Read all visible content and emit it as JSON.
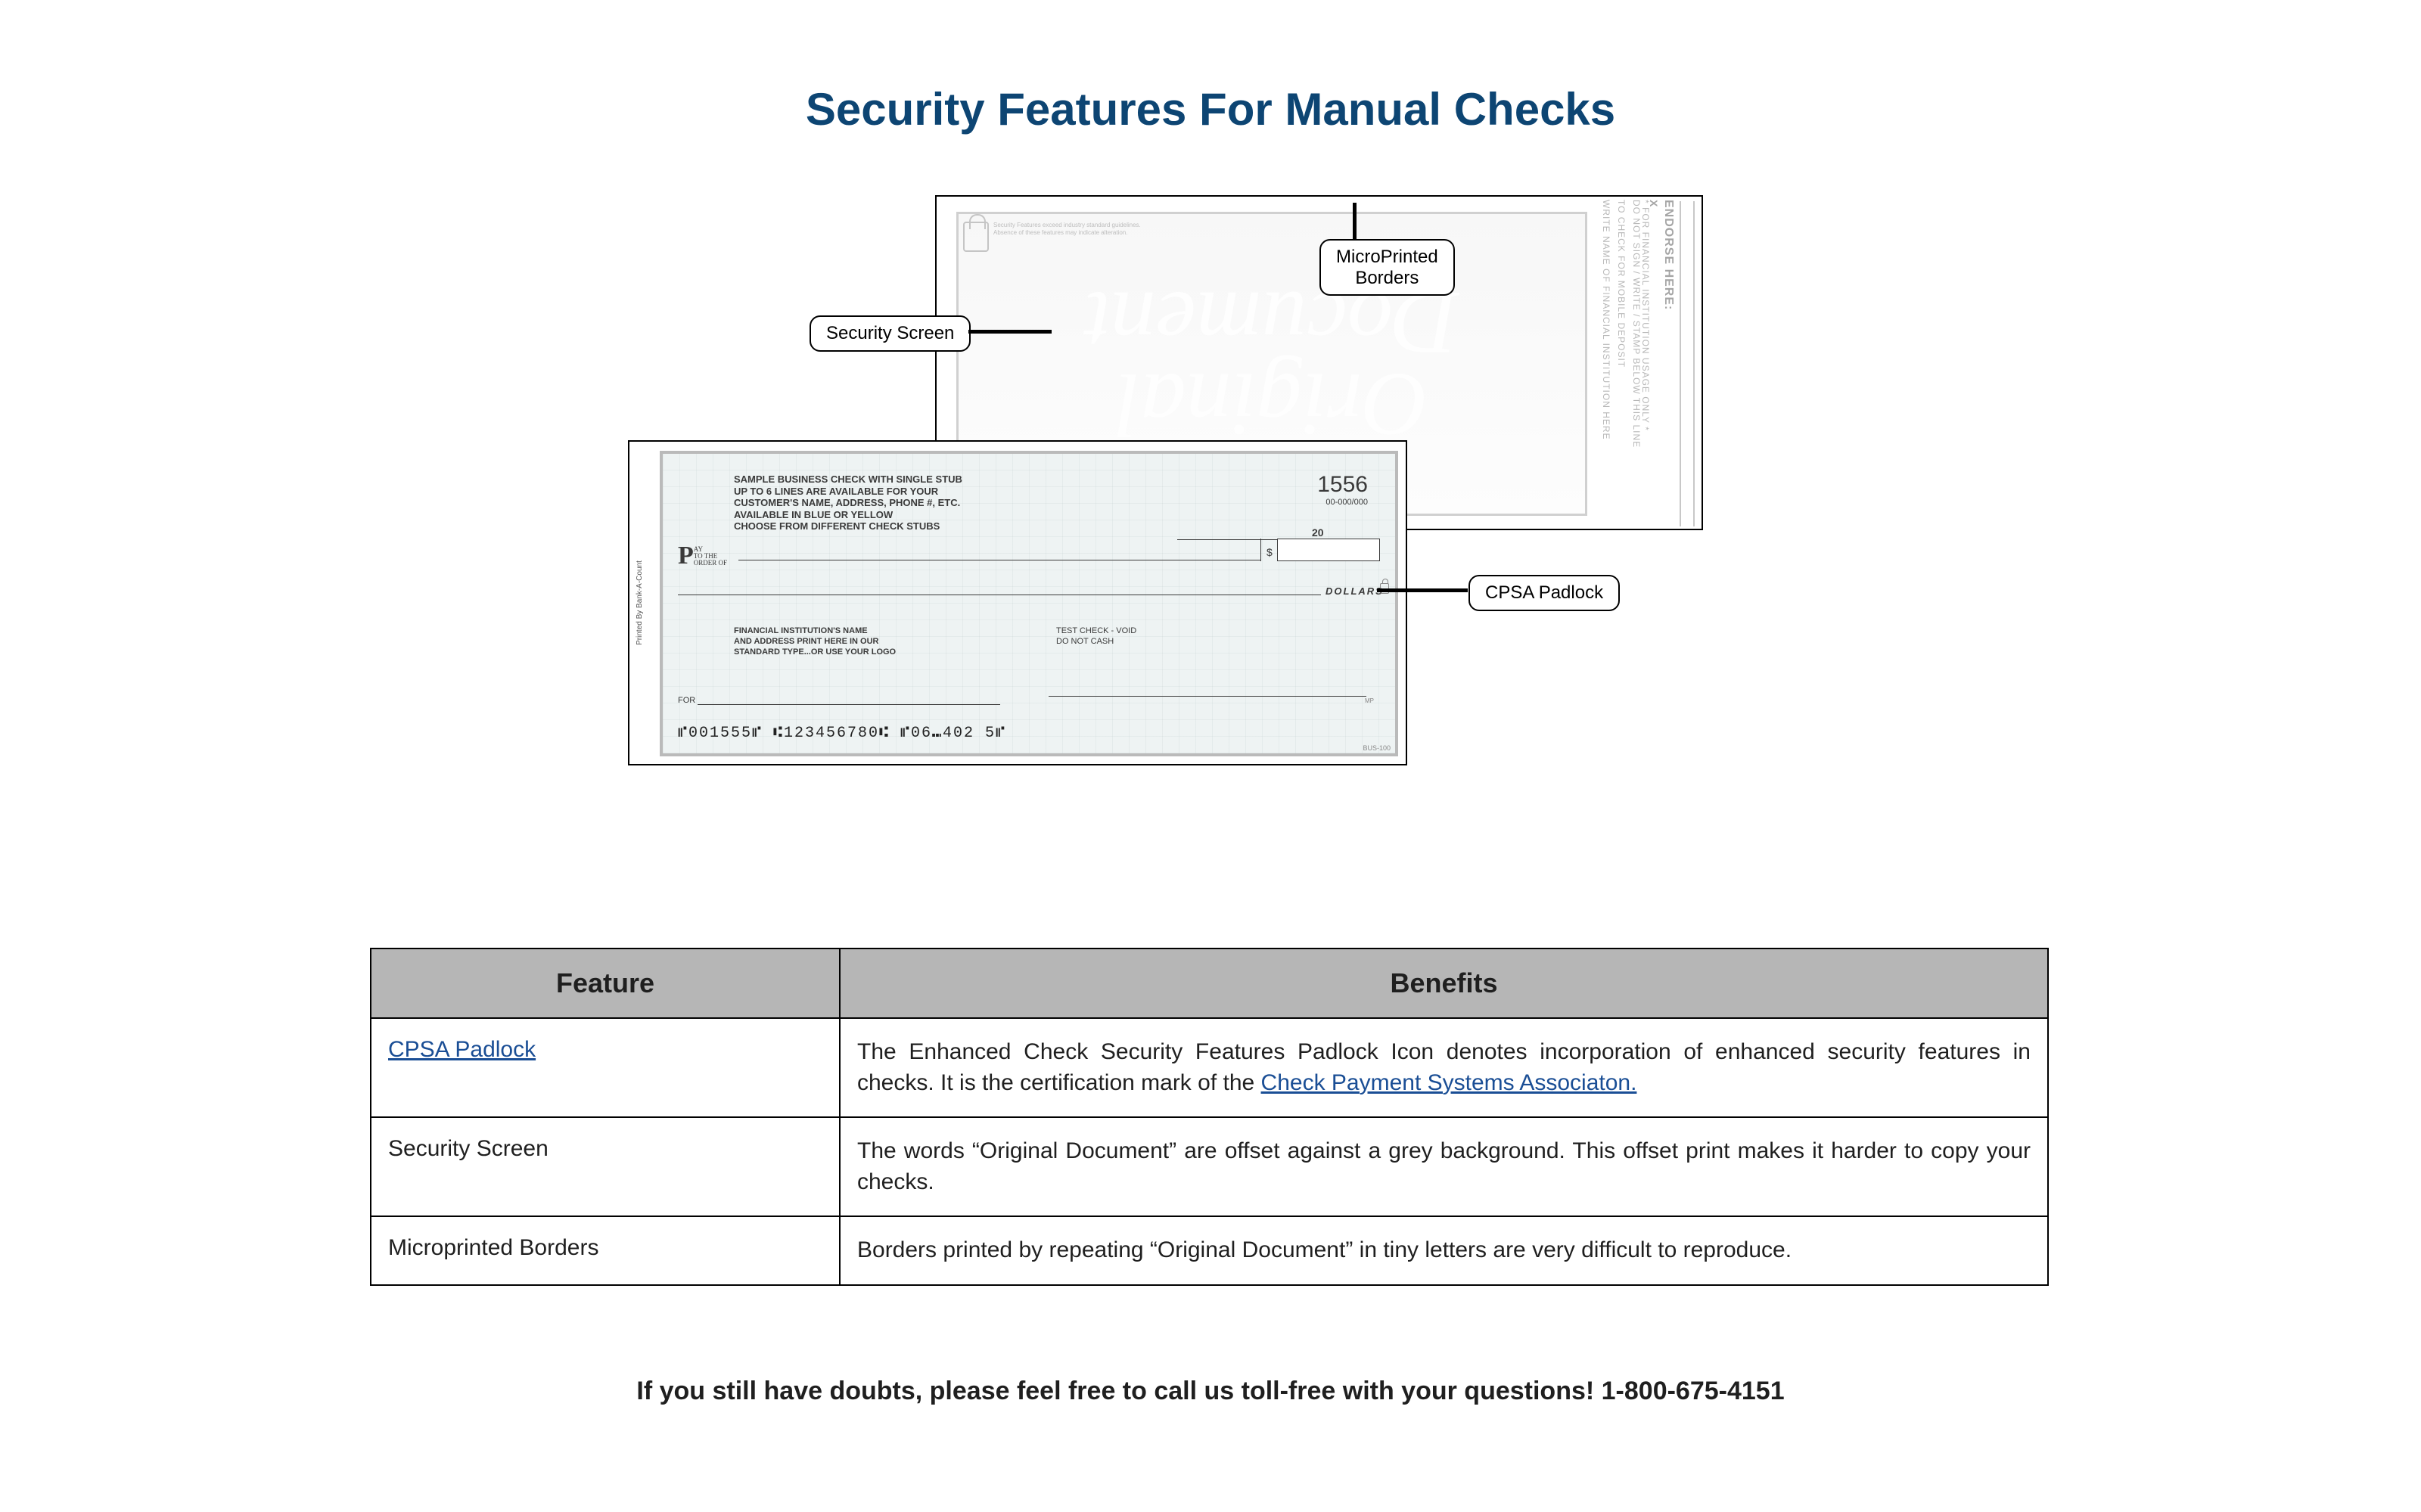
{
  "title": "Security Features For Manual Checks",
  "callouts": {
    "security_screen": "Security Screen",
    "microprinted_borders": "MicroPrinted\nBorders",
    "cpsa_padlock": "CPSA Padlock"
  },
  "check_back": {
    "watermark_line1": "Original",
    "watermark_line2": "Document",
    "right_lines": {
      "endorse": "ENDORSE HERE:",
      "x": "X",
      "l1": "WRITE NAME OF FINANCIAL INSTITUTION HERE",
      "l2": "TO CHECK FOR MOBILE DEPOSIT",
      "l3": "DO NOT SIGN / WRITE / STAMP BELOW THIS LINE",
      "l4": "* FOR FINANCIAL INSTITUTION USAGE ONLY *"
    },
    "security_block": "Security Features exceed industry standard guidelines.\nAbsence of these features may indicate alteration."
  },
  "check_front": {
    "side_text": "Printed By Bank-A-Count",
    "sample_lines": [
      "SAMPLE BUSINESS CHECK WITH SINGLE STUB",
      "UP TO 6 LINES ARE AVAILABLE FOR YOUR",
      "CUSTOMER'S NAME, ADDRESS, PHONE #, ETC.",
      "AVAILABLE IN BLUE OR YELLOW",
      "CHOOSE FROM DIFFERENT CHECK STUBS"
    ],
    "number": "1556",
    "number_sub": "00-000/000",
    "date_twenty": "20",
    "pay_big": "P",
    "pay_small": "AY\nTO THE\nORDER OF",
    "dollar_sign": "$",
    "dollars_label": "DOLLARS",
    "bank_lines": [
      "FINANCIAL INSTITUTION'S NAME",
      "AND ADDRESS PRINT HERE IN OUR",
      "STANDARD TYPE...OR USE YOUR LOGO"
    ],
    "test_void": "TEST CHECK - VOID\nDO NOT CASH",
    "for_label": "FOR",
    "mp": "MP",
    "micr": "⑈001555⑈  ⑆123456780⑆   ⑈06⑉402  5⑈",
    "bus": "BUS-100"
  },
  "table": {
    "headers": {
      "feature": "Feature",
      "benefits": "Benefits"
    },
    "rows": [
      {
        "feature_link": "CPSA Padlock",
        "benefit_pre": "The Enhanced Check Security Features Padlock Icon denotes incorporation of enhanced security features in checks. It is the certification mark of the ",
        "benefit_link": "Check Payment Systems Associaton.",
        "benefit_post": ""
      },
      {
        "feature": "Security Screen",
        "benefit": "The words “Original Document” are offset against a grey background. This offset print makes it harder to copy your checks."
      },
      {
        "feature": "Microprinted Borders",
        "benefit": "Borders printed by repeating “Original Document” in tiny letters are very difficult to reproduce."
      }
    ]
  },
  "footer": "If you still have doubts, please feel free to call us toll-free with your questions! 1-800-675-4151"
}
